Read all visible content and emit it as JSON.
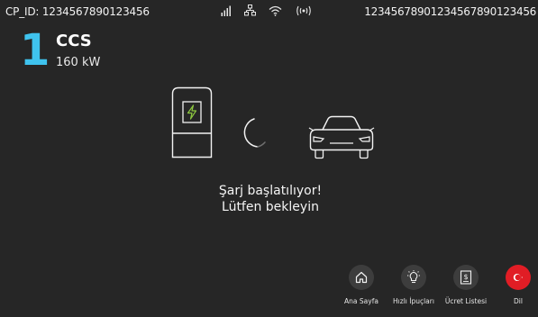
{
  "status_bar": {
    "cp_id": "CP_ID: 1234567890123456",
    "serial": "12345678901234567890123456",
    "icons": [
      "signal-icon",
      "ethernet-icon",
      "wifi-icon",
      "broadcast-icon"
    ]
  },
  "connector": {
    "number": "1",
    "type": "CCS",
    "power": "160 kW"
  },
  "message": {
    "line1": "Şarj başlatılıyor!",
    "line2": "Lütfen bekleyin"
  },
  "nav": {
    "home": "Ana Sayfa",
    "tips": "Hızlı İpuçları",
    "tariff": "Ücret Listesi",
    "language": "Dil"
  },
  "colors": {
    "background": "#262626",
    "accent": "#3fc3ee",
    "lightning": "#8cc63f",
    "language_red": "#e11d25"
  }
}
